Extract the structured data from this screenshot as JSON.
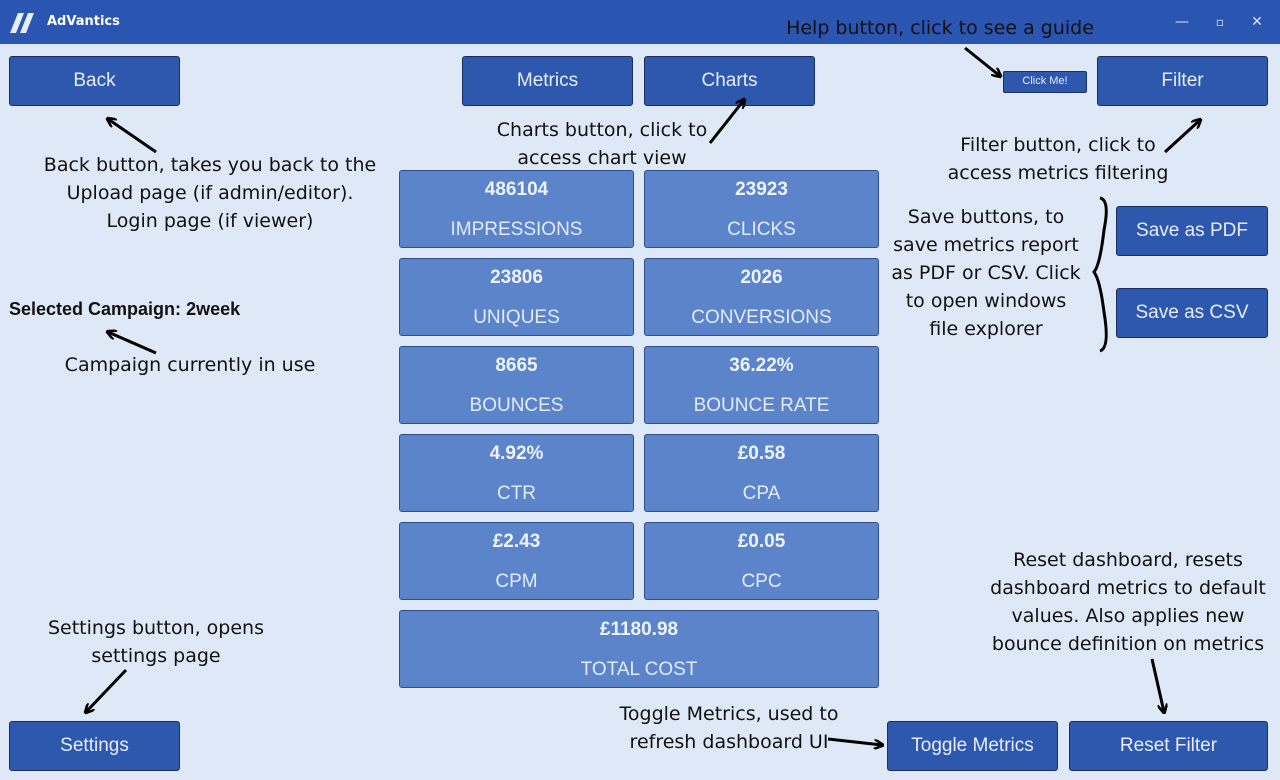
{
  "app": {
    "title": "AdVantics"
  },
  "window_controls": {
    "minimize": "—",
    "maximize": "▫",
    "close": "✕"
  },
  "toolbar": {
    "back": "Back",
    "metrics": "Metrics",
    "charts": "Charts",
    "help": "Click Me!",
    "filter": "Filter",
    "save_pdf": "Save as PDF",
    "save_csv": "Save as CSV",
    "settings": "Settings",
    "toggle_metrics": "Toggle Metrics",
    "reset_filter": "Reset Filter"
  },
  "campaign": {
    "label": "Selected Campaign:",
    "value": "2week"
  },
  "metrics": [
    {
      "value": "486104",
      "label": "IMPRESSIONS"
    },
    {
      "value": "23923",
      "label": "CLICKS"
    },
    {
      "value": "23806",
      "label": "UNIQUES"
    },
    {
      "value": "2026",
      "label": "CONVERSIONS"
    },
    {
      "value": "8665",
      "label": "BOUNCES"
    },
    {
      "value": "36.22%",
      "label": "BOUNCE RATE"
    },
    {
      "value": "4.92%",
      "label": "CTR"
    },
    {
      "value": "£0.58",
      "label": "CPA"
    },
    {
      "value": "£2.43",
      "label": "CPM"
    },
    {
      "value": "£0.05",
      "label": "CPC"
    },
    {
      "value": "£1180.98",
      "label": "TOTAL COST"
    }
  ],
  "annotations": {
    "help": "Help button, click to see a guide",
    "back": [
      "Back button, takes you back to the",
      "Upload page (if admin/editor).",
      "Login page (if viewer)"
    ],
    "charts": [
      "Charts button, click to",
      "access chart view"
    ],
    "filter": [
      "Filter button, click to",
      "access metrics filtering"
    ],
    "save": [
      "Save buttons, to",
      "save metrics report",
      "as PDF or CSV. Click",
      "to open windows",
      "file explorer"
    ],
    "campaign": "Campaign currently in use",
    "settings": [
      "Settings button, opens",
      "settings page"
    ],
    "reset": [
      "Reset dashboard, resets",
      "dashboard metrics to default",
      "values. Also applies new",
      "bounce definition on metrics"
    ],
    "toggle": [
      "Toggle Metrics, used to",
      "refresh dashboard UI"
    ]
  },
  "colors": {
    "titlebar": "#2a55b0",
    "background": "#dfe8f6",
    "button": "#2e58ae",
    "card": "#5b84cb"
  }
}
